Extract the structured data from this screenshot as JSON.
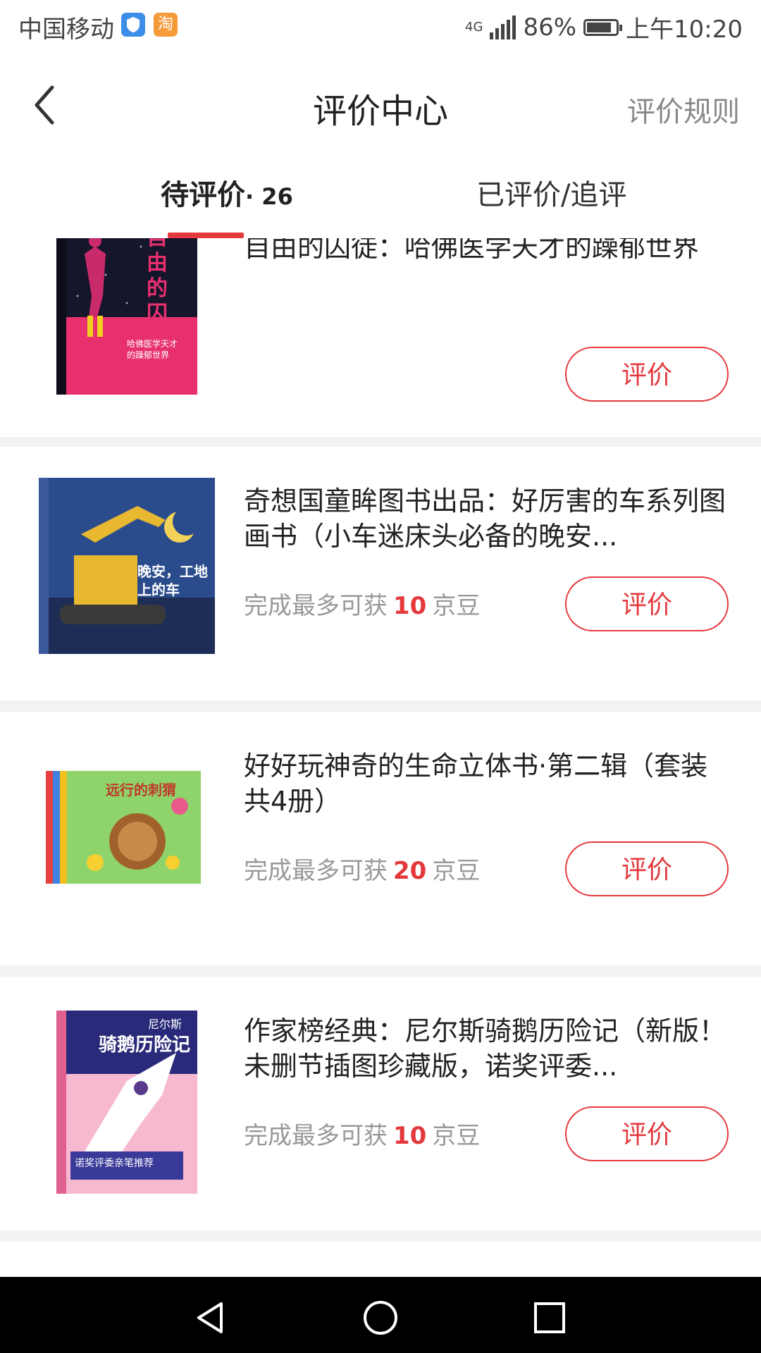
{
  "status_bar": {
    "carrier": "中国移动",
    "network": "4G",
    "battery": "86%",
    "battery_level": 0.86,
    "time": "上午10:20",
    "icons": [
      "shield-app-icon",
      "taobao-app-icon",
      "signal-icon",
      "battery-icon"
    ]
  },
  "header": {
    "back_icon": "chevron-left-icon",
    "title": "评价中心",
    "rules_link": "评价规则"
  },
  "tabs": [
    {
      "label": "待评价",
      "count": "· 26",
      "active": true
    },
    {
      "label": "已评价/追评",
      "active": false
    }
  ],
  "items": [
    {
      "name": "自由的囚徒：哈佛医学天才的躁郁世界",
      "reward_prefix": "",
      "beans": "",
      "reward_suffix": "",
      "button": "评价",
      "cover_title": "自由的囚徒",
      "cover_subtitle": "哈佛医学天才的躁郁世界",
      "cover_colors": [
        "#1a1a2e",
        "#e8306f"
      ]
    },
    {
      "name": "奇想国童眸图书出品：好厉害的车系列图画书（小车迷床头必备的晚安...",
      "reward_prefix": "完成最多可获",
      "beans": "10",
      "reward_suffix": "京豆",
      "button": "评价",
      "cover_title": "晚安，工地上的车",
      "cover_colors": [
        "#2b4c8c",
        "#e8b830"
      ]
    },
    {
      "name": "好好玩神奇的生命立体书·第二辑（套装共4册）",
      "reward_prefix": "完成最多可获",
      "beans": "20",
      "reward_suffix": "京豆",
      "button": "评价",
      "cover_title": "远行的刺猬",
      "cover_colors": [
        "#5cb85c",
        "#f0d030"
      ]
    },
    {
      "name": "作家榜经典：尼尔斯骑鹅历险记（新版！未删节插图珍藏版，诺奖评委...",
      "reward_prefix": "完成最多可获",
      "beans": "10",
      "reward_suffix": "京豆",
      "button": "评价",
      "cover_title": "骑鹅历险记",
      "cover_top": "尼尔斯",
      "cover_banner": "诺奖评委亲笔推荐",
      "cover_colors": [
        "#2a2a7a",
        "#f4a0c0"
      ]
    }
  ],
  "nav_bar": {
    "icons": [
      "back-triangle-icon",
      "home-circle-icon",
      "recents-square-icon"
    ]
  }
}
